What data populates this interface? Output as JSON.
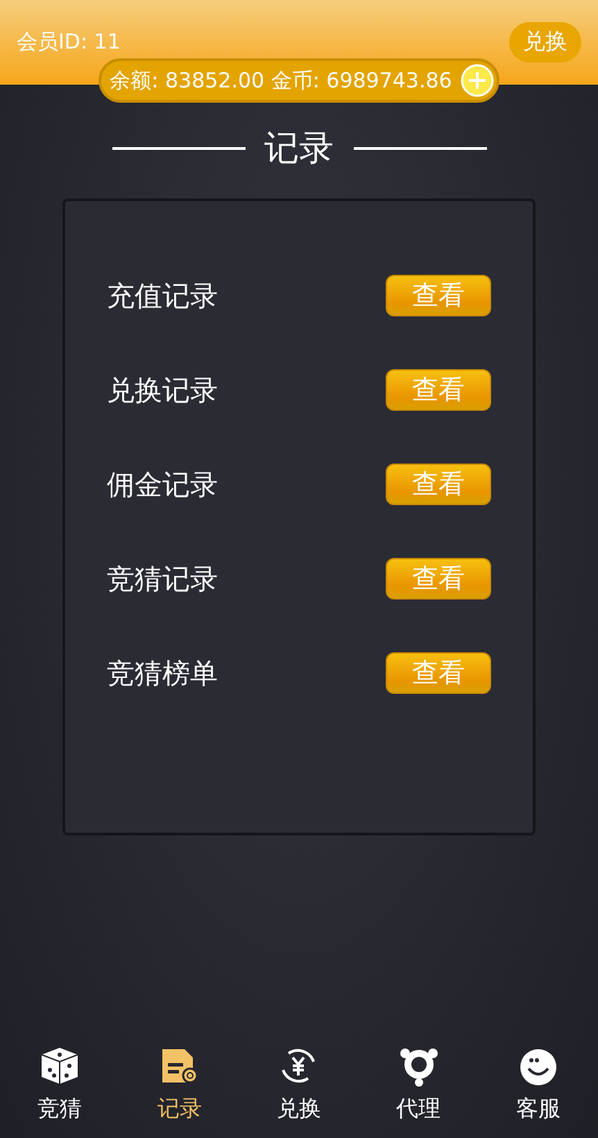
{
  "header": {
    "member_id": "会员ID: 11",
    "exchange_button": "兑换",
    "balance": "余额: 83852.00 金币: 6989743.86"
  },
  "title": "记录",
  "records": [
    {
      "label": "充值记录",
      "button": "查看"
    },
    {
      "label": "兑换记录",
      "button": "查看"
    },
    {
      "label": "佣金记录",
      "button": "查看"
    },
    {
      "label": "竞猜记录",
      "button": "查看"
    },
    {
      "label": "竞猜榜单",
      "button": "查看"
    }
  ],
  "nav": [
    {
      "kind": "dice",
      "label": "竞猜",
      "selected": false
    },
    {
      "kind": "document",
      "label": "记录",
      "selected": true
    },
    {
      "kind": "exchange",
      "label": "兑换",
      "selected": false
    },
    {
      "kind": "agent",
      "label": "代理",
      "selected": false
    },
    {
      "kind": "service",
      "label": "客服",
      "selected": false
    }
  ]
}
